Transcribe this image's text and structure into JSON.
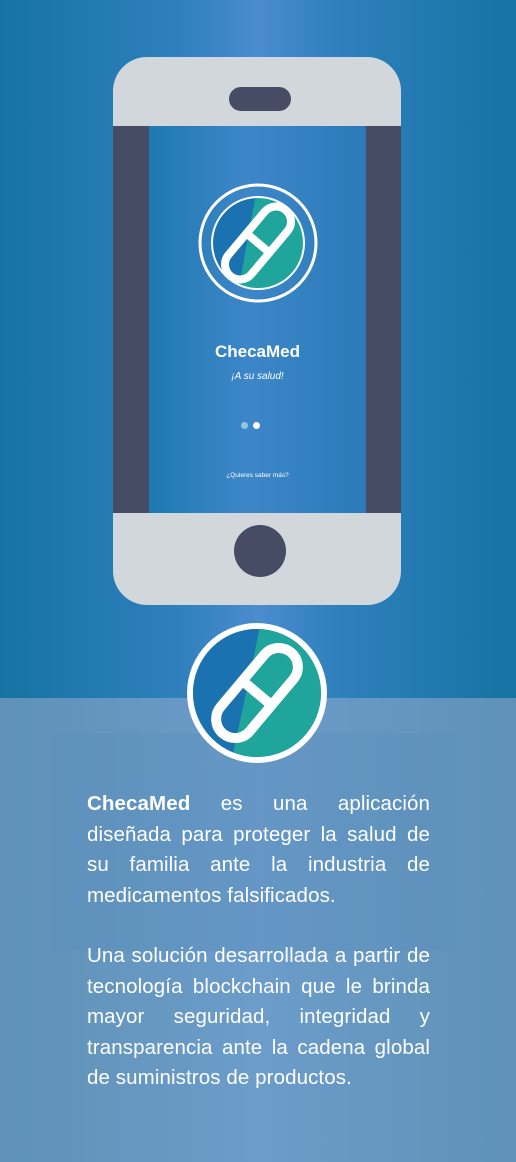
{
  "phone": {
    "app_name": "ChecaMed",
    "tagline": "¡A su salud!",
    "more_link": "¿Quieres saber más?",
    "carousel": {
      "total": 2,
      "active": 1
    }
  },
  "description": {
    "brand": "ChecaMed",
    "p1_rest": " es una aplicación diseñada para proteger la salud de su familia ante la industria de medicamentos falsificados.",
    "p2": "Una solución desarrollada a partir de tecnología blockchain que le brinda mayor seguridad, integridad y transparencia ante la cadena global de suministros de productos."
  },
  "colors": {
    "background_blue": "#2f80bd",
    "phone_body": "#d2d7db",
    "phone_dark": "#454c63",
    "logo_teal": "#1a9c9a",
    "logo_blue": "#1a6ca6"
  },
  "icons": [
    "checamed-logo-icon"
  ]
}
